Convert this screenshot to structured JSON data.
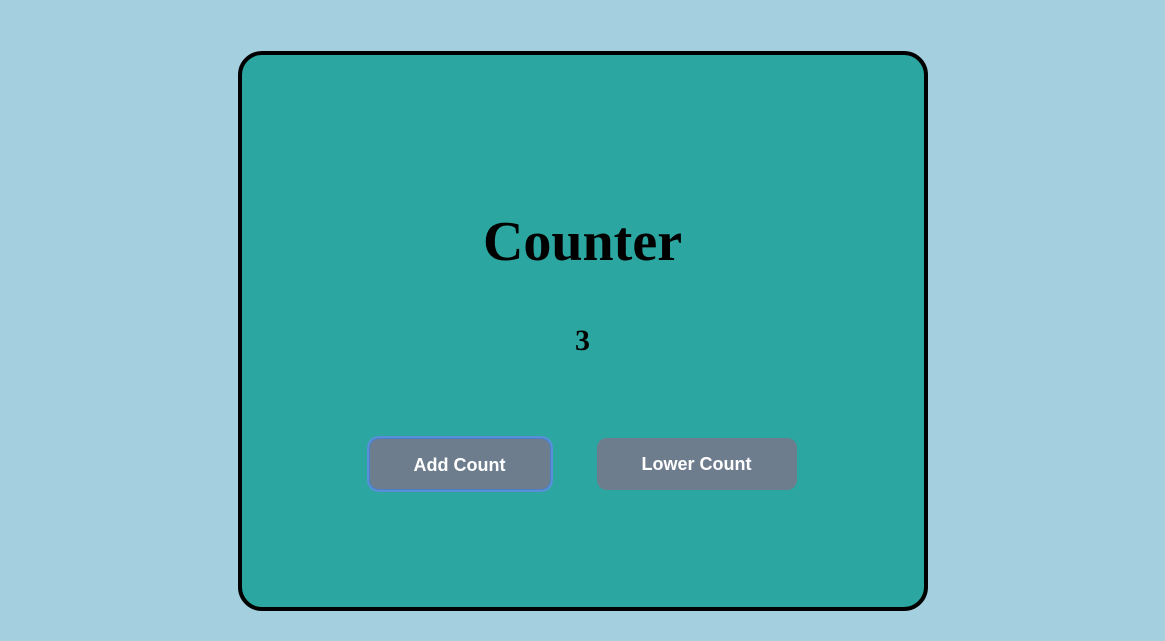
{
  "counter": {
    "title": "Counter",
    "value": "3",
    "add_label": "Add Count",
    "lower_label": "Lower Count"
  }
}
